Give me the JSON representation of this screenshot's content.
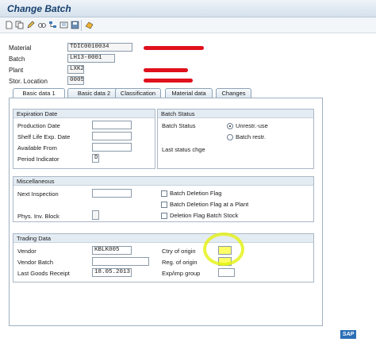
{
  "window": {
    "title": "Change Batch"
  },
  "toolbar": {
    "icons": [
      "new-document-icon",
      "copy-icon",
      "edit-pencil-icon",
      "display-change-icon",
      "hierarchy-icon",
      "object-list-icon",
      "save-icon",
      "layout-icon"
    ]
  },
  "header": {
    "material_label": "Material",
    "material_value": "TDIC0010034",
    "batch_label": "Batch",
    "batch_value": "LH13-0001",
    "plant_label": "Plant",
    "plant_value": "LXK2",
    "stor_label": "Stor. Location",
    "stor_value": "0005"
  },
  "tabs": [
    {
      "label": "Basic data 1",
      "active": true
    },
    {
      "label": "Basic data 2"
    },
    {
      "label": "Classification"
    },
    {
      "label": "Material data"
    },
    {
      "label": "Changes"
    }
  ],
  "expiration": {
    "title": "Expiration Date",
    "production_label": "Production Date",
    "production_value": "",
    "shelf_label": "Shelf Life Exp. Date",
    "shelf_value": "",
    "avail_label": "Available From",
    "avail_value": "",
    "period_label": "Period Indicator",
    "period_value": "D"
  },
  "batch_status": {
    "title": "Batch Status",
    "status_label": "Batch Status",
    "unrestricted_label": "Unrestr.-use",
    "restricted_label": "Batch restr.",
    "last_change_label": "Last status chge"
  },
  "misc": {
    "title": "Miscellaneous",
    "next_insp_label": "Next Inspection",
    "phys_block_label": "Phys. Inv. Block",
    "deletion_flag_label": "Batch Deletion Flag",
    "deletion_plant_label": "Batch Deletion Flag at a Plant",
    "deletion_stock_label": "Deletion Flag Batch Stock"
  },
  "trading": {
    "title": "Trading Data",
    "vendor_label": "Vendor",
    "vendor_value": "KBLK005",
    "vendor_batch_label": "Vendor Batch",
    "vendor_batch_value": "",
    "last_gr_label": "Last Goods Receipt",
    "last_gr_value": "18.05.2013",
    "ctry_label": "Ctry of origin",
    "ctry_value": "",
    "reg_label": "Reg. of origin",
    "reg_value": "",
    "expimp_label": "Exp/imp group",
    "expimp_value": ""
  },
  "branding": {
    "logo_text": "SAP"
  },
  "colors": {
    "highlight": "#e3f10f",
    "redaction": "#e0101c",
    "title": "#18406e"
  }
}
